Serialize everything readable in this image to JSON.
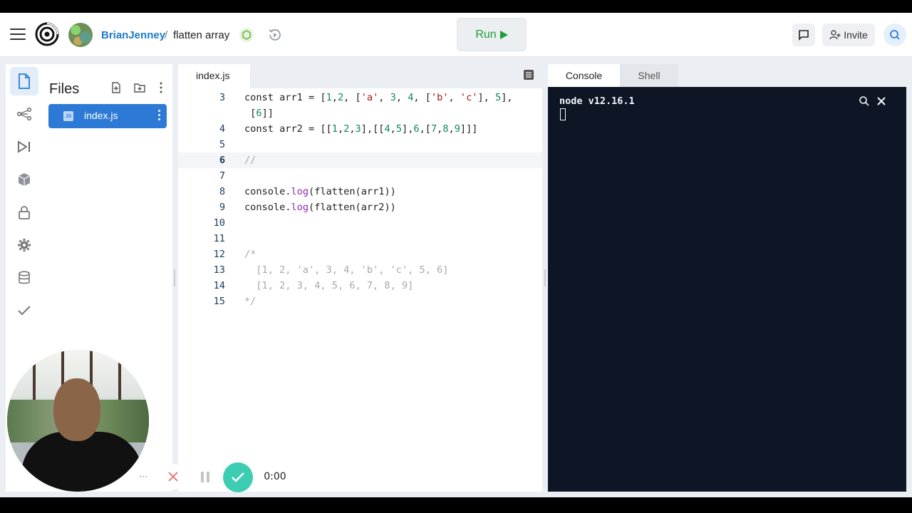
{
  "header": {
    "owner": "BrianJenney",
    "separator": "/",
    "repl_name": "flatten array",
    "run_label": "Run",
    "invite_label": "Invite"
  },
  "files": {
    "title": "Files",
    "items": [
      {
        "name": "index.js",
        "type": "js",
        "active": true
      }
    ]
  },
  "editor": {
    "tab_label": "index.js",
    "lines": [
      {
        "num": "3",
        "text": "const arr1 = [1,2, ['a', 3, 4, ['b', 'c'], 5],"
      },
      {
        "num": "",
        "text": " [6]]"
      },
      {
        "num": "4",
        "text": "const arr2 = [[1,2,3],[[4,5],6,[7,8,9]]]"
      },
      {
        "num": "5",
        "text": ""
      },
      {
        "num": "6",
        "text": "//",
        "current": true
      },
      {
        "num": "7",
        "text": ""
      },
      {
        "num": "8",
        "text": "console.log(flatten(arr1))"
      },
      {
        "num": "9",
        "text": "console.log(flatten(arr2))"
      },
      {
        "num": "10",
        "text": ""
      },
      {
        "num": "11",
        "text": ""
      },
      {
        "num": "12",
        "text": "/*"
      },
      {
        "num": "13",
        "text": "  [1, 2, 'a', 3, 4, 'b', 'c', 5, 6]"
      },
      {
        "num": "14",
        "text": "  [1, 2, 3, 4, 5, 6, 7, 8, 9]"
      },
      {
        "num": "15",
        "text": "*/"
      }
    ]
  },
  "console": {
    "tabs": [
      "Console",
      "Shell"
    ],
    "active_tab": "Console",
    "output": "node v12.16.1"
  },
  "recorder": {
    "more_label": "···",
    "timer": "0:00"
  },
  "colors": {
    "accent": "#2d7ad6",
    "run_green": "#1f9e38",
    "console_bg": "#0e1525",
    "record_done": "#3dcdb3"
  }
}
